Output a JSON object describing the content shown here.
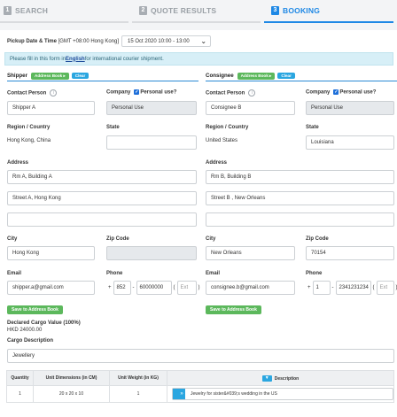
{
  "steps": [
    {
      "num": "1",
      "label": "SEARCH"
    },
    {
      "num": "2",
      "label": "QUOTE RESULTS"
    },
    {
      "num": "3",
      "label": "BOOKING"
    }
  ],
  "pickup": {
    "label": "Pickup Date & Time",
    "timezone": "[GMT +08:00 Hong Kong]",
    "value": "15 Oct 2020 10:00 - 13:00"
  },
  "notice": {
    "before": "Please fill in this form in ",
    "link": "English",
    "after": " for international courier shipment."
  },
  "address_book_label": "Address Book ▸",
  "clear_label": "Clear",
  "labels": {
    "contact_person": "Contact Person",
    "company": "Company",
    "personal_use": "Personal use?",
    "region": "Region / Country",
    "state": "State",
    "address": "Address",
    "city": "City",
    "zip": "Zip Code",
    "email": "Email",
    "phone": "Phone",
    "save": "Save to Address Book",
    "ext": "Ext"
  },
  "shipper": {
    "title": "Shipper",
    "contact": "Shipper A",
    "company": "Personal Use",
    "region": "Hong Kong, China",
    "state": "",
    "address1": "Rm A, Building A",
    "address2": "Street A, Hong Kong",
    "address3": "",
    "city": "Hong Kong",
    "zip": "",
    "email": "shipper.a@gmail.com",
    "phone_code": "852",
    "phone_number": "60000000",
    "ext": ""
  },
  "consignee": {
    "title": "Consignee",
    "contact": "Consignee B",
    "company": "Personal Use",
    "region": "United States",
    "state": "Louisiana",
    "address1": "Rm B, Building B",
    "address2": "Street B , New Orleans",
    "address3": "",
    "city": "New Orleans",
    "zip": "70154",
    "email": "consignee.b@gmail.com",
    "phone_code": "1",
    "phone_number": "2341231234",
    "ext": ""
  },
  "cargo": {
    "declared_label": "Declared Cargo Value (100%)",
    "declared_value": "HKD 24000.00",
    "description_label": "Cargo Description",
    "description": "Jewellery"
  },
  "table": {
    "headers": [
      "Quantity",
      "Unit Dimensions (in CM)",
      "Unit Weight (in KG)",
      "Description"
    ],
    "rows": [
      {
        "qty": "1",
        "dims": "20 x 20 x 10",
        "weight": "1",
        "desc": "Jewelry for sister&#039;s wedding in the US"
      }
    ]
  }
}
